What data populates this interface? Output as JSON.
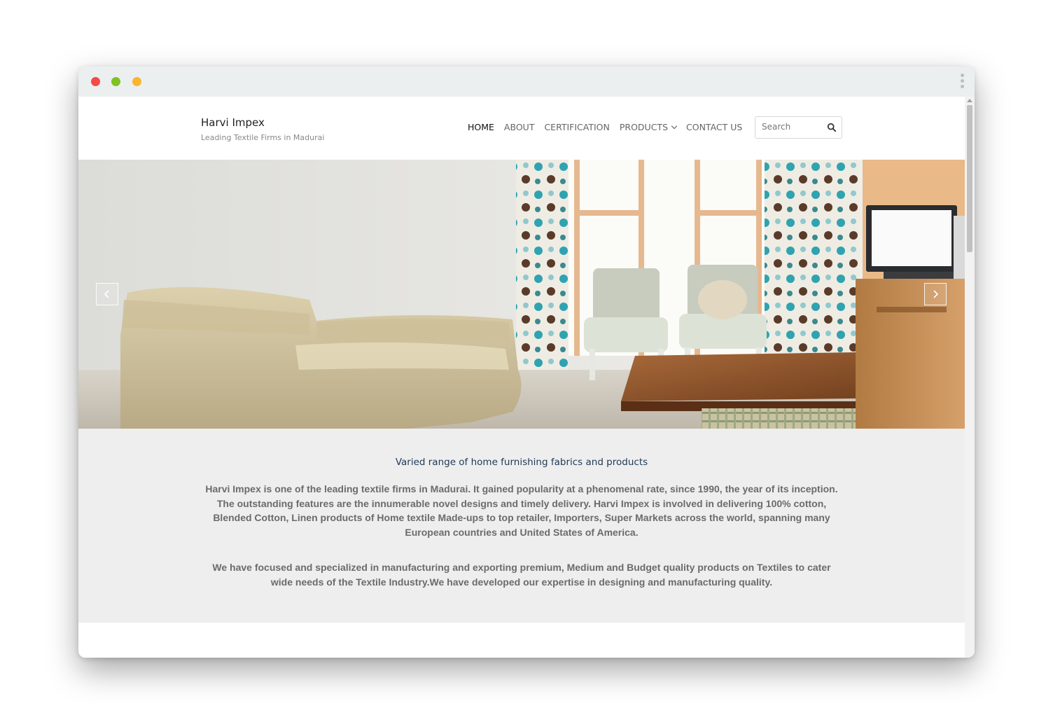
{
  "site": {
    "name": "Harvi Impex",
    "tagline": "Leading Textile Firms in Madurai"
  },
  "nav": {
    "items": [
      {
        "label": "HOME",
        "active": true
      },
      {
        "label": "ABOUT",
        "active": false
      },
      {
        "label": "CERTIFICATION",
        "active": false
      },
      {
        "label": "PRODUCTS",
        "active": false,
        "dropdown": true
      },
      {
        "label": "CONTACT US",
        "active": false
      }
    ]
  },
  "search": {
    "placeholder": "Search",
    "icon": "search-icon"
  },
  "hero": {
    "image": "living-room-sofa-armchairs-curtains",
    "prev_icon": "chevron-left-icon",
    "next_icon": "chevron-right-icon"
  },
  "intro": {
    "heading": "Varied range of home furnishing fabrics and products",
    "paragraph1": "Harvi Impex is one of the leading textile firms in Madurai. It gained popularity at a phenomenal rate, since 1990, the year of its inception. The outstanding features are the innumerable novel designs and timely delivery. Harvi Impex is involved in delivering 100% cotton, Blended Cotton, Linen products of Home textile Made-ups to top retailer, Importers, Super Markets across the world, spanning many European countries and United States of America.",
    "paragraph2": "We have focused and specialized in manufacturing and exporting premium, Medium and Budget quality products on Textiles to cater wide needs of the Textile Industry.We have developed our expertise in designing and manufacturing quality."
  },
  "colors": {
    "heading": "#1e3a56",
    "body_text": "#6b6b6b",
    "content_bg": "#eeeeee",
    "titlebar": "#eceff0"
  }
}
